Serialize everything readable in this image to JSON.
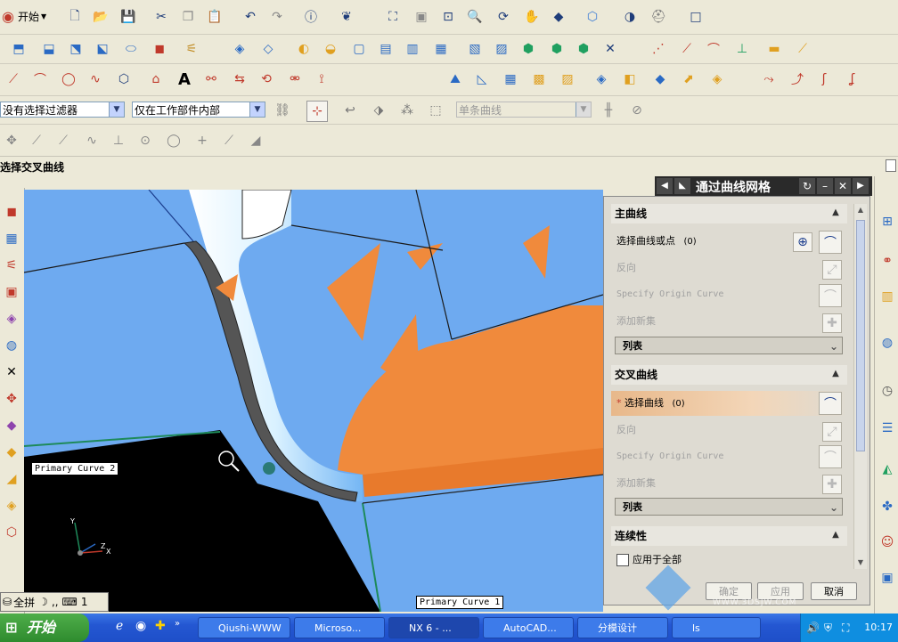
{
  "toolbar": {
    "start_menu_label": "开始",
    "filter_select": "没有选择过滤器",
    "scope_select": "仅在工作部件内部",
    "curve_rule_select": "单条曲线"
  },
  "prompt": {
    "text": "选择交叉曲线"
  },
  "viewport": {
    "label_primary_curve_2": "Primary Curve  2",
    "label_primary_curve_1": "Primary Curve  1",
    "axis_x": "X",
    "axis_y": "Y",
    "axis_z": "Z",
    "mini_label_all": "全拼",
    "mini_label_num": "1"
  },
  "dialog": {
    "title": "通过曲线网格",
    "main_curves": {
      "header": "主曲线",
      "select_label": "选择曲线或点",
      "select_count": "(0)",
      "reverse": "反向",
      "specify_origin": "Specify Origin Curve",
      "add_new_set": "添加新集",
      "list_label": "列表"
    },
    "cross_curves": {
      "header": "交叉曲线",
      "select_label": "选择曲线",
      "select_count": "(0)",
      "reverse": "反向",
      "specify_origin": "Specify Origin Curve",
      "add_new_set": "添加新集",
      "list_label": "列表"
    },
    "continuity": {
      "header": "连续性",
      "apply_all": "应用于全部"
    },
    "ok_label": "确定",
    "apply_label": "应用",
    "cancel_label": "取消"
  },
  "watermark": {
    "site": "WWW.3DSJW.COM"
  },
  "taskbar": {
    "start_label": "开始",
    "tasks": [
      {
        "label": "Qiushi-WWW"
      },
      {
        "label": "Microso..."
      },
      {
        "label": "NX 6 - ..."
      },
      {
        "label": "AutoCAD..."
      },
      {
        "label": "分模设计"
      },
      {
        "label": "ls"
      }
    ],
    "clock": "10:17"
  },
  "colors": {
    "viewport_blue": "#6eaaf0",
    "surface_orange": "#f08a3c",
    "highlight_bar": "#e8b88a",
    "taskbar_blue": "#2457d2",
    "start_green": "#3c9c3a"
  }
}
